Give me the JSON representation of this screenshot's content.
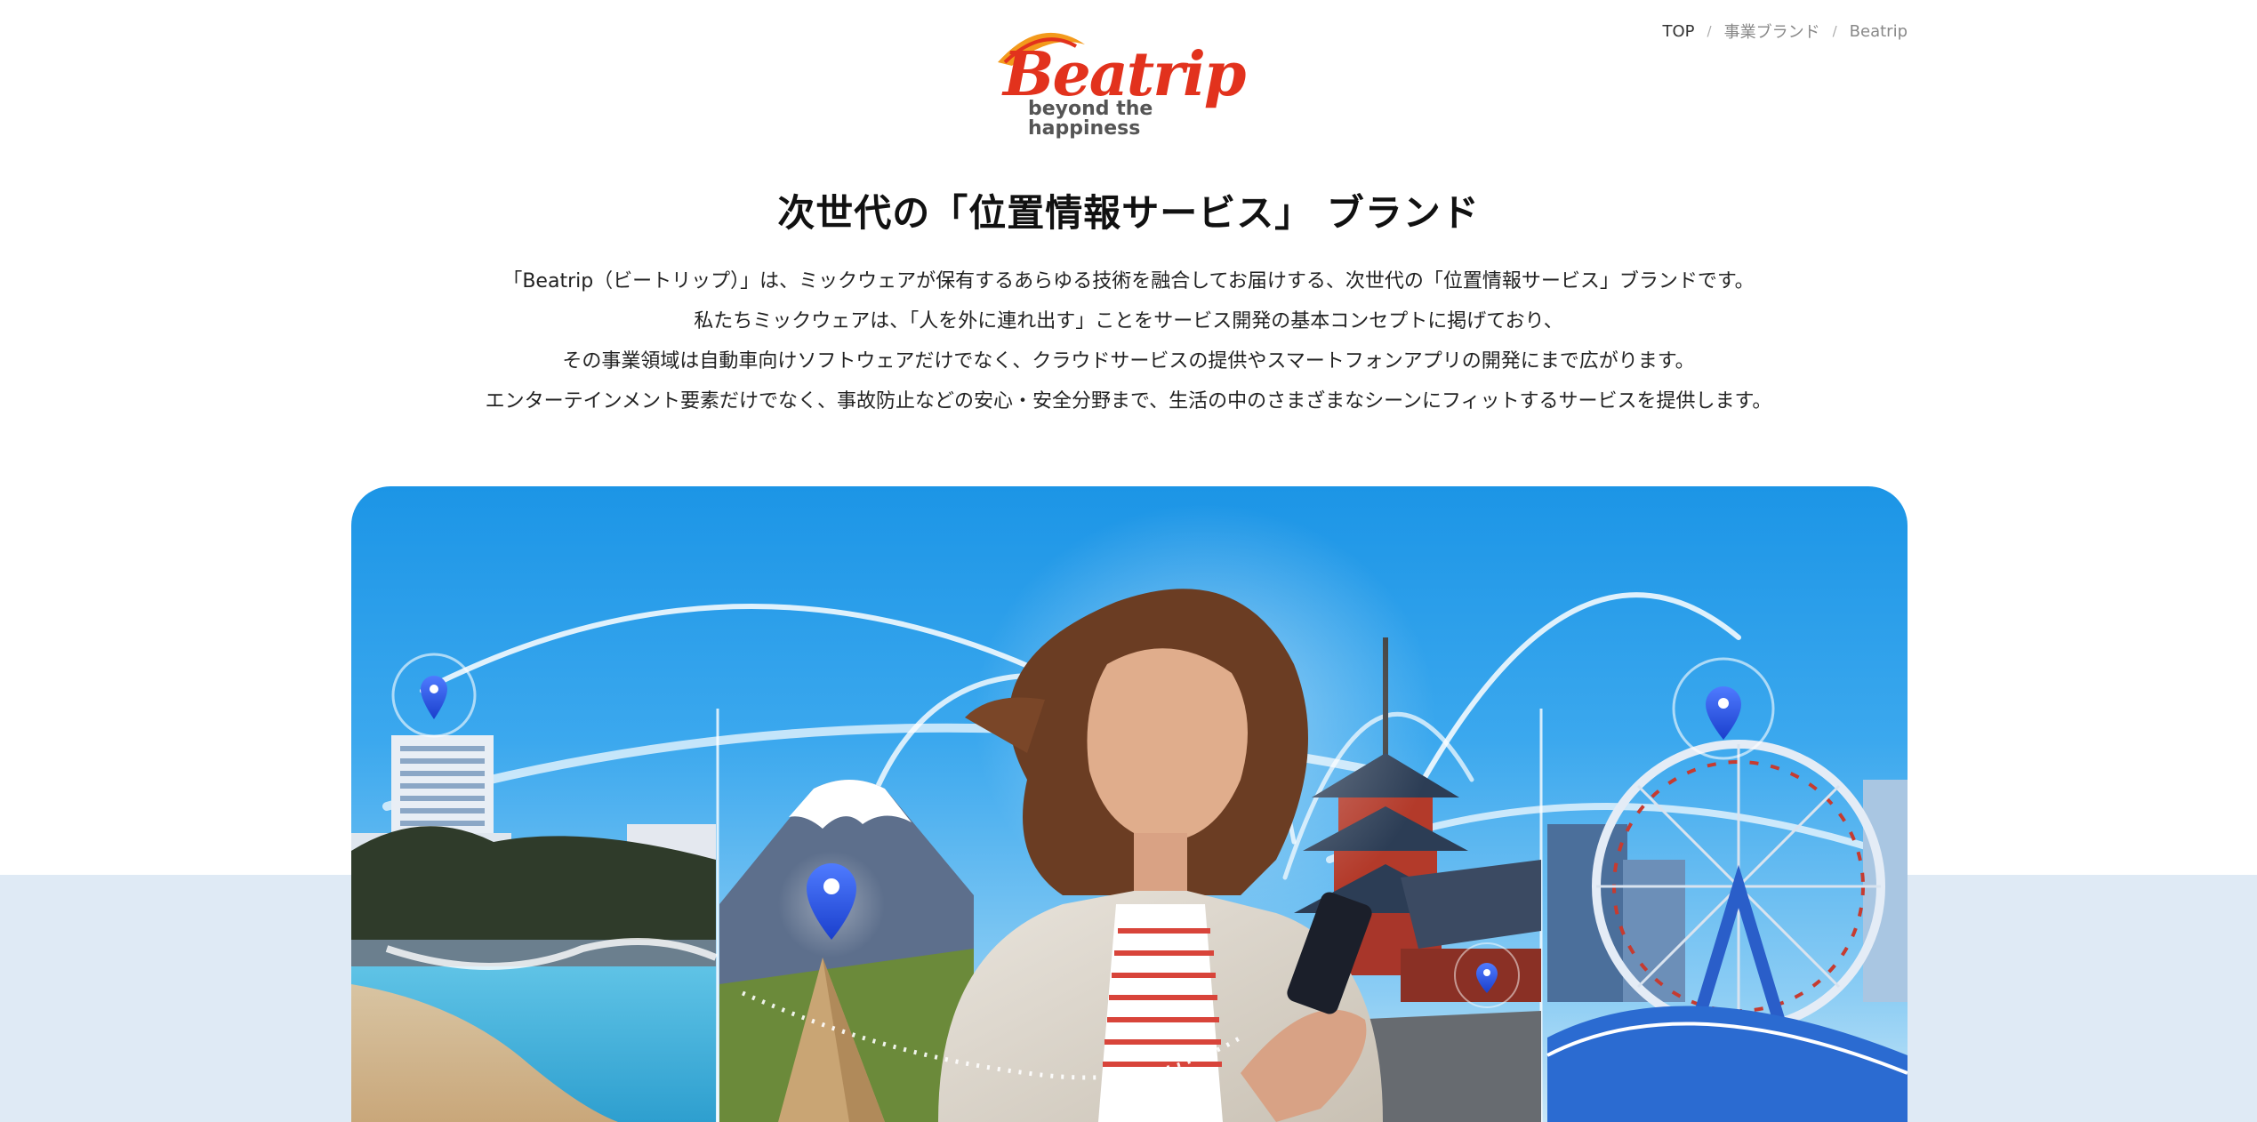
{
  "brand": {
    "wordmark": "Beatrip",
    "tagline": "beyond the happiness",
    "primary_color": "#e2321d",
    "accent_color": "#f39a1c"
  },
  "breadcrumb": {
    "items": [
      "TOP",
      "事業ブランド",
      "Beatrip"
    ],
    "separator": "/"
  },
  "main": {
    "title": "次世代の「位置情報サービス」 ブランド",
    "paragraphs": [
      "「Beatrip（ビートリップ）」は、ミックウェアが保有するあらゆる技術を融合してお届けする、次世代の「位置情報サービス」ブランドです。",
      "私たちミックウェアは、「人を外に連れ出す」ことをサービス開発の基本コンセプトに掲げており、",
      "その事業領域は自動車向けソフトウェアだけでなく、クラウドサービスの提供やスマートフォンアプリの開発にまで広がります。",
      "エンターテインメント要素だけでなく、事故防止などの安心・安全分野まで、生活の中のさまざまなシーンにフィットするサービスを提供します。"
    ]
  },
  "hero": {
    "scenes": [
      "beach-hotel",
      "mount-fuji-camp",
      "woman-with-smartphone",
      "pagoda-temple",
      "ferris-wheel"
    ],
    "pin_icon": "location-pin-icon",
    "sky_color": "#1c95e6"
  }
}
